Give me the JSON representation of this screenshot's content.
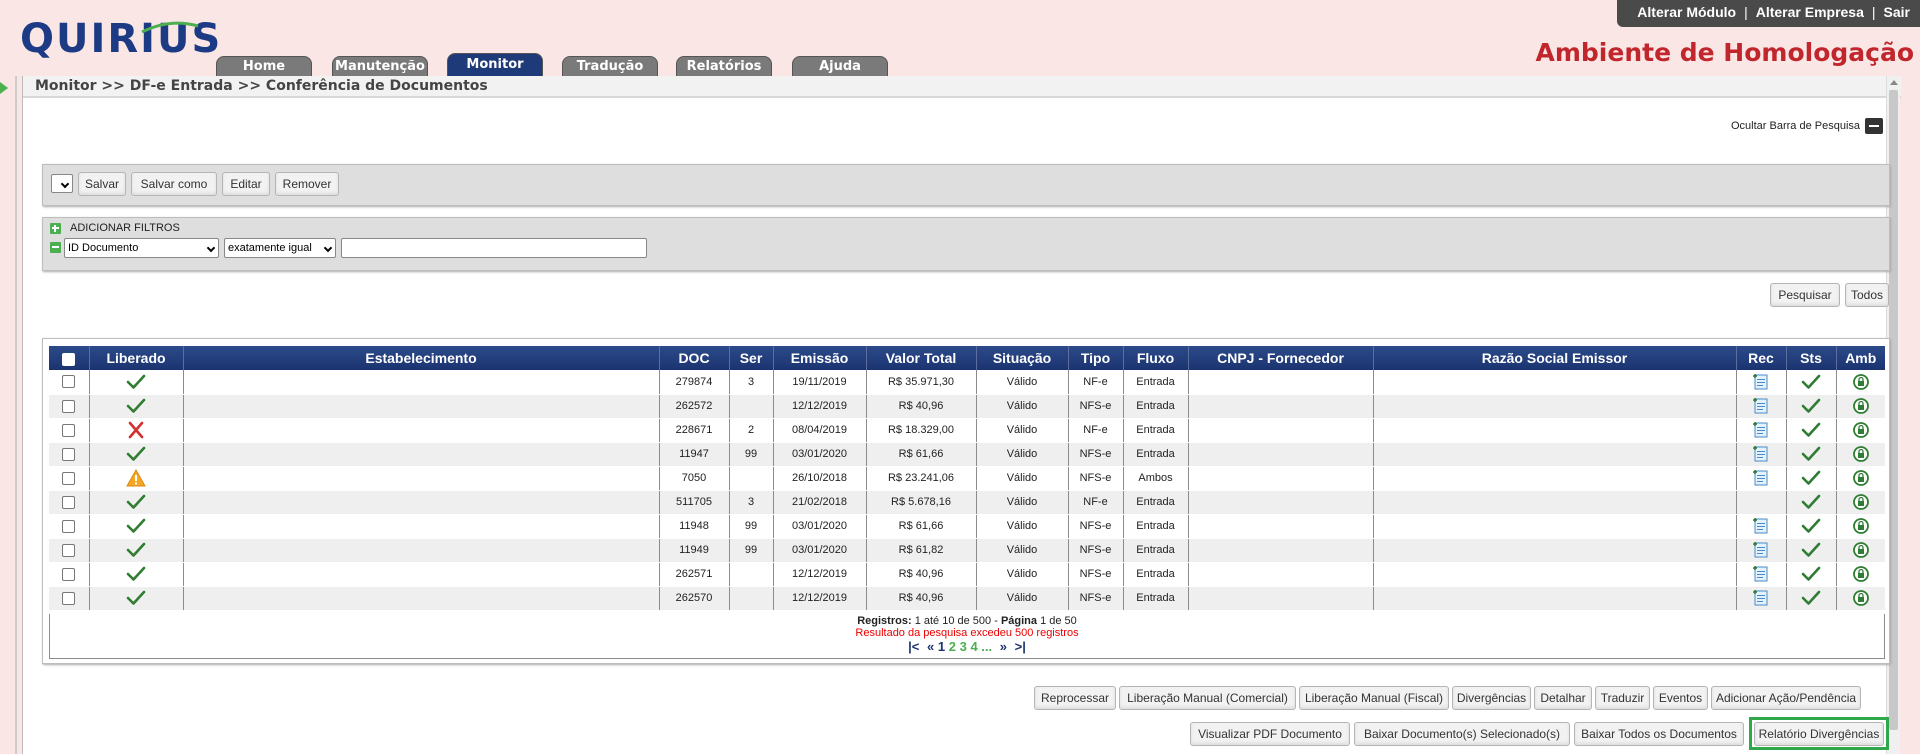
{
  "header": {
    "logo": "QUIRIUS",
    "top_links": [
      "Alterar Módulo",
      "Alterar Empresa",
      "Sair"
    ],
    "environment": "Ambiente de Homologação",
    "tabs": [
      "Home",
      "Manutenção",
      "Monitor",
      "Tradução",
      "Relatórios",
      "Ajuda"
    ],
    "active_tab": "Monitor"
  },
  "breadcrumb": "Monitor >> DF-e Entrada >> Conferência de Documentos",
  "search_bar": {
    "hide_label": "Ocultar Barra de Pesquisa",
    "saved_buttons": [
      "Salvar",
      "Salvar como",
      "Editar",
      "Remover"
    ],
    "add_filters_label": "ADICIONAR FILTROS",
    "filter_field": "ID Documento",
    "filter_operator": "exatamente igual",
    "filter_value": "",
    "search_button": "Pesquisar",
    "all_button": "Todos"
  },
  "grid": {
    "columns": [
      "",
      "Liberado",
      "Estabelecimento",
      "DOC",
      "Ser",
      "Emissão",
      "Valor Total",
      "Situação",
      "Tipo",
      "Fluxo",
      "CNPJ - Fornecedor",
      "Razão Social Emissor",
      "Rec",
      "Sts",
      "Amb"
    ],
    "rows": [
      {
        "liberado": "check",
        "estab": "",
        "doc": "279874",
        "ser": "3",
        "emissao": "19/11/2019",
        "valor": "R$ 35.971,30",
        "situacao": "Válido",
        "tipo": "NF-e",
        "fluxo": "Entrada",
        "cnpj": "",
        "razao": "",
        "rec": true
      },
      {
        "liberado": "check",
        "estab": "",
        "doc": "262572",
        "ser": "",
        "emissao": "12/12/2019",
        "valor": "R$ 40,96",
        "situacao": "Válido",
        "tipo": "NFS-e",
        "fluxo": "Entrada",
        "cnpj": "",
        "razao": "",
        "rec": true
      },
      {
        "liberado": "cross",
        "estab": "",
        "doc": "228671",
        "ser": "2",
        "emissao": "08/04/2019",
        "valor": "R$ 18.329,00",
        "situacao": "Válido",
        "tipo": "NF-e",
        "fluxo": "Entrada",
        "cnpj": "",
        "razao": "",
        "rec": true
      },
      {
        "liberado": "check",
        "estab": "",
        "doc": "11947",
        "ser": "99",
        "emissao": "03/01/2020",
        "valor": "R$ 61,66",
        "situacao": "Válido",
        "tipo": "NFS-e",
        "fluxo": "Entrada",
        "cnpj": "",
        "razao": "",
        "rec": true
      },
      {
        "liberado": "warning",
        "estab": "",
        "doc": "7050",
        "ser": "",
        "emissao": "26/10/2018",
        "valor": "R$ 23.241,06",
        "situacao": "Válido",
        "tipo": "NFS-e",
        "fluxo": "Ambos",
        "cnpj": "",
        "razao": "",
        "rec": true
      },
      {
        "liberado": "check",
        "estab": "",
        "doc": "511705",
        "ser": "3",
        "emissao": "21/02/2018",
        "valor": "R$ 5.678,16",
        "situacao": "Válido",
        "tipo": "NF-e",
        "fluxo": "Entrada",
        "cnpj": "",
        "razao": "",
        "rec": false
      },
      {
        "liberado": "check",
        "estab": "",
        "doc": "11948",
        "ser": "99",
        "emissao": "03/01/2020",
        "valor": "R$ 61,66",
        "situacao": "Válido",
        "tipo": "NFS-e",
        "fluxo": "Entrada",
        "cnpj": "",
        "razao": "",
        "rec": true
      },
      {
        "liberado": "check",
        "estab": "",
        "doc": "11949",
        "ser": "99",
        "emissao": "03/01/2020",
        "valor": "R$ 61,82",
        "situacao": "Válido",
        "tipo": "NFS-e",
        "fluxo": "Entrada",
        "cnpj": "",
        "razao": "",
        "rec": true
      },
      {
        "liberado": "check",
        "estab": "",
        "doc": "262571",
        "ser": "",
        "emissao": "12/12/2019",
        "valor": "R$ 40,96",
        "situacao": "Válido",
        "tipo": "NFS-e",
        "fluxo": "Entrada",
        "cnpj": "",
        "razao": "",
        "rec": true
      },
      {
        "liberado": "check",
        "estab": "",
        "doc": "262570",
        "ser": "",
        "emissao": "12/12/2019",
        "valor": "R$ 40,96",
        "situacao": "Válido",
        "tipo": "NFS-e",
        "fluxo": "Entrada",
        "cnpj": "",
        "razao": "",
        "rec": true
      }
    ]
  },
  "pager": {
    "registros_label": "Registros:",
    "registros_text": "1 até 10 de 500 -",
    "pagina_label": "Página",
    "pagina_text": "1 de 50",
    "warning": "Resultado da pesquisa excedeu 500 registros",
    "pages": [
      "1",
      "2",
      "3",
      "4",
      "..."
    ],
    "current_page": "1"
  },
  "actions_row1": [
    "Reprocessar",
    "Liberação Manual (Comercial)",
    "Liberação Manual (Fiscal)",
    "Divergências",
    "Detalhar",
    "Traduzir",
    "Eventos",
    "Adicionar Ação/Pendência"
  ],
  "actions_row2": [
    "Visualizar PDF Documento",
    "Baixar Documento(s) Selecionado(s)",
    "Baixar Todos os Documentos",
    "Relatório Divergências"
  ],
  "colors": {
    "brand": "#1d3a84",
    "env_text": "#c0262c",
    "grid_header": "#1b3470",
    "ok_green": "#2e7d32",
    "error_red": "#d32f2f",
    "warn_orange": "#f5a623",
    "highlight": "#2ea84a"
  }
}
